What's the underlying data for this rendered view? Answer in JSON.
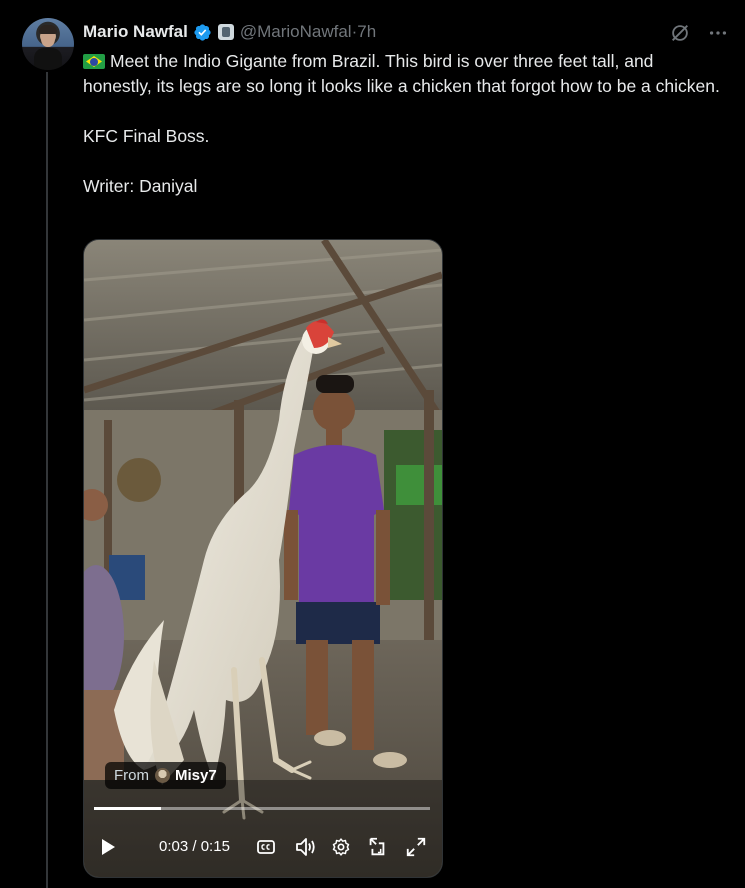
{
  "author": {
    "name": "Mario Nawfal",
    "handle": "@MarioNawfal",
    "separator": " · ",
    "time": "7h",
    "verified": true
  },
  "tweet": {
    "line1": "Meet the Indio Gigante from Brazil. This bird is over three feet tall, and honestly, its legs are so long it looks like a chicken that forgot how to be a chicken.",
    "line2": "KFC Final Boss.",
    "line3": "Writer: Daniyal",
    "flag_icon": "brazil-flag-icon"
  },
  "video": {
    "source_prefix": "From",
    "source_user": "Misy7",
    "current_time": "0:03",
    "time_separator": " / ",
    "duration": "0:15",
    "progress_fraction": 0.2
  },
  "colors": {
    "background": "#000000",
    "text": "#e7e9ea",
    "secondary_text": "#71767b",
    "verified_blue": "#1d9bf0"
  }
}
